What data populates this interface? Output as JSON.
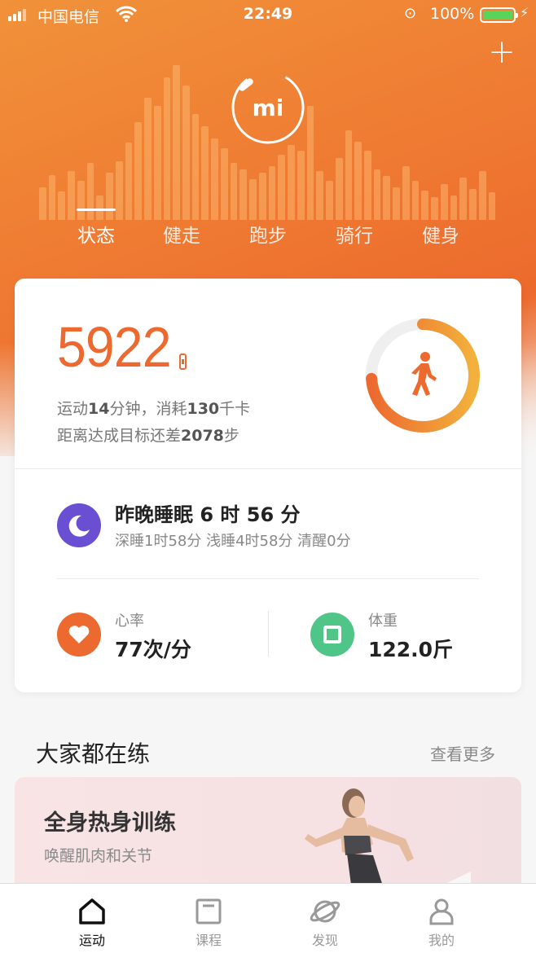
{
  "status_bar": {
    "carrier": "中国电信",
    "time": "22:49",
    "battery": "100%"
  },
  "header": {
    "logo_text": "mi",
    "tabs": [
      "状态",
      "健走",
      "跑步",
      "骑行",
      "健身"
    ],
    "active_tab": "状态"
  },
  "activity": {
    "steps": "5922",
    "line1_prefix": "运动",
    "line1_minutes": "14",
    "line1_mid": "分钟，消耗",
    "line1_kcal": "130",
    "line1_suffix": "千卡",
    "line2_prefix": "距离达成目标还差",
    "line2_steps": "2078",
    "line2_suffix": "步",
    "goal_progress": 0.74
  },
  "sleep": {
    "title": "昨晚睡眠 6 时 56 分",
    "detail": "深睡1时58分 浅睡4时58分 清醒0分"
  },
  "heart_rate": {
    "label": "心率",
    "value": "77次/分"
  },
  "weight": {
    "label": "体重",
    "value": "122.0斤"
  },
  "section": {
    "title": "大家都在练",
    "more": "查看更多"
  },
  "promo": {
    "title": "全身热身训练",
    "subtitle": "唤醒肌肉和关节"
  },
  "tabbar": {
    "items": [
      {
        "label": "运动",
        "icon": "home-icon"
      },
      {
        "label": "课程",
        "icon": "course-icon"
      },
      {
        "label": "发现",
        "icon": "planet-icon"
      },
      {
        "label": "我的",
        "icon": "profile-icon"
      }
    ],
    "active": "运动"
  },
  "colors": {
    "accent": "#ec6a2f",
    "sleep": "#6b4fd3",
    "heart": "#ec6a2f",
    "weight": "#4fc587"
  }
}
